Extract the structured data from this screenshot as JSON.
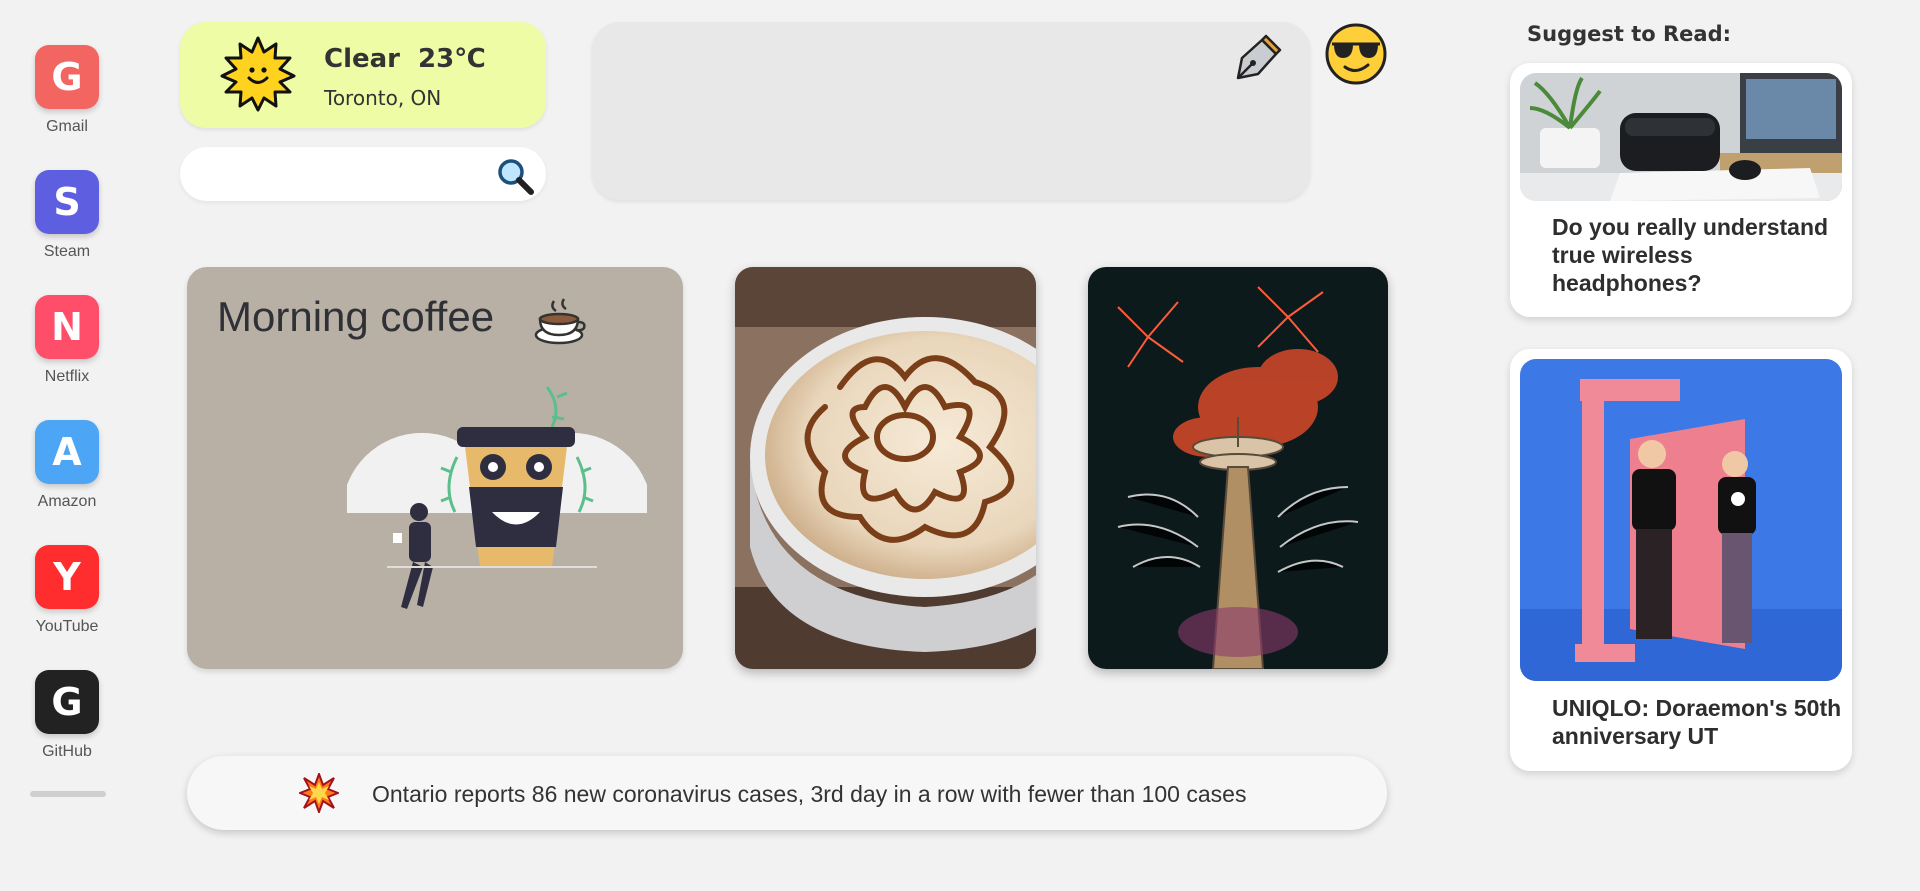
{
  "dock": {
    "apps": [
      {
        "letter": "G",
        "label": "Gmail",
        "color": "#f36561"
      },
      {
        "letter": "S",
        "label": "Steam",
        "color": "#5e5fe0"
      },
      {
        "letter": "N",
        "label": "Netflix",
        "color": "#ff4e6a"
      },
      {
        "letter": "A",
        "label": "Amazon",
        "color": "#4da6f5"
      },
      {
        "letter": "Y",
        "label": "YouTube",
        "color": "#ff2d2d"
      },
      {
        "letter": "G",
        "label": "GitHub",
        "color": "#222222"
      }
    ]
  },
  "weather": {
    "condition": "Clear",
    "temperature": "23℃",
    "location": "Toronto, ON",
    "icon": "sun-icon"
  },
  "search": {
    "value": "",
    "placeholder": "",
    "icon": "magnifier-icon"
  },
  "notepad": {
    "icon": "pen-icon",
    "avatar_icon": "sunglasses-emoji-icon"
  },
  "cards": {
    "morning_title": "Morning coffee",
    "morning_icon": "coffee-cup-icon",
    "photo1": "latte-art-photo",
    "photo2": "fireworks-space-needle-photo"
  },
  "news": {
    "icon": "explosion-icon",
    "headline": "Ontario reports 86 new coronavirus cases, 3rd day in a row with fewer than 100 cases"
  },
  "suggest": {
    "heading": "Suggest to Read:",
    "articles": [
      {
        "title": "Do you really understand true wireless headphones?"
      },
      {
        "title": "UNIQLO: Doraemon's 50th anniversary UT"
      }
    ]
  }
}
